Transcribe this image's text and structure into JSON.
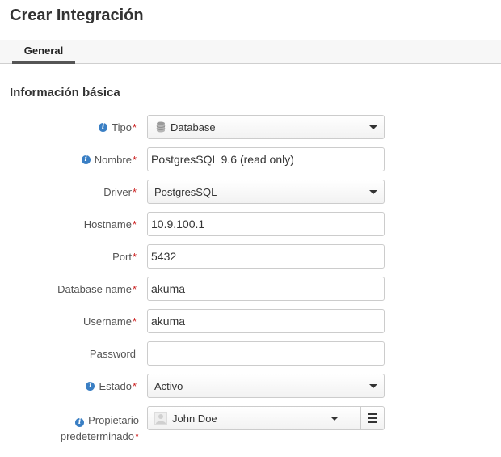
{
  "page": {
    "title": "Crear Integración"
  },
  "tabs": [
    {
      "label": "General",
      "active": true
    }
  ],
  "section": {
    "title": "Información básica"
  },
  "form": {
    "tipo": {
      "label": "Tipo",
      "value": "Database",
      "icon": "database-icon"
    },
    "nombre": {
      "label": "Nombre",
      "value": "PostgresSQL 9.6 (read only)"
    },
    "driver": {
      "label": "Driver",
      "value": "PostgresSQL"
    },
    "hostname": {
      "label": "Hostname",
      "value": "10.9.100.1"
    },
    "port": {
      "label": "Port",
      "value": "5432"
    },
    "database_name": {
      "label": "Database name",
      "value": "akuma"
    },
    "username": {
      "label": "Username",
      "value": "akuma"
    },
    "password": {
      "label": "Password",
      "value": ""
    },
    "estado": {
      "label": "Estado",
      "value": "Activo"
    },
    "propietario": {
      "label_line1": "Propietario",
      "label_line2": "predeterminado",
      "value": "John Doe"
    }
  },
  "required_marker": "*",
  "info_glyph": "i",
  "colors": {
    "required": "#cc1f1f",
    "info": "#3a7fc4",
    "tab_underline": "#555555"
  }
}
